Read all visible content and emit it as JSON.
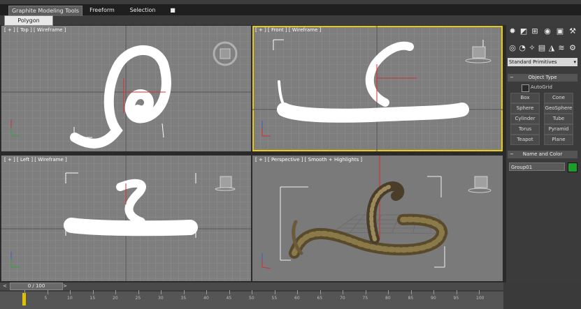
{
  "ribbon": {
    "tabs": [
      "Graphite Modeling Tools",
      "Freeform",
      "Selection"
    ],
    "toggle_label": "■",
    "subtab": "Polygon Modeling"
  },
  "viewports": {
    "top": {
      "label": "[ + ] [ Top ] [ Wireframe ]"
    },
    "front": {
      "label": "[ + ] [ Front ] [ Wireframe ]"
    },
    "left": {
      "label": "[ + ] [ Left ] [ Wireframe ]"
    },
    "perspective": {
      "label": "[ + ] [ Perspective ] [ Smooth + Highlights ]"
    }
  },
  "command_panel": {
    "tab_icons": [
      "create-icon",
      "modify-icon",
      "hierarchy-icon",
      "motion-icon",
      "display-icon",
      "utilities-icon"
    ],
    "category_icons": [
      "geometry-icon",
      "shapes-icon",
      "lights-icon",
      "cameras-icon",
      "helpers-icon",
      "spacewarps-icon",
      "systems-icon"
    ],
    "dropdown_value": "Standard Primitives",
    "object_type": {
      "title": "Object Type",
      "autogrid": "AutoGrid",
      "buttons": [
        "Box",
        "Cone",
        "Sphere",
        "GeoSphere",
        "Cylinder",
        "Tube",
        "Torus",
        "Pyramid",
        "Teapot",
        "Plane"
      ]
    },
    "name_and_color": {
      "title": "Name and Color",
      "name_value": "Group01",
      "color": "#1e9b2a"
    }
  },
  "timeline": {
    "frame_counter": "0 / 100",
    "ticks": [
      "5",
      "10",
      "15",
      "20",
      "25",
      "30",
      "35",
      "40",
      "45",
      "50",
      "55",
      "60",
      "65",
      "70",
      "75",
      "80",
      "85",
      "90",
      "95",
      "100"
    ]
  },
  "colors": {
    "active_viewport_border": "#f0d000",
    "viewport_bg": "#7e7e7e"
  }
}
